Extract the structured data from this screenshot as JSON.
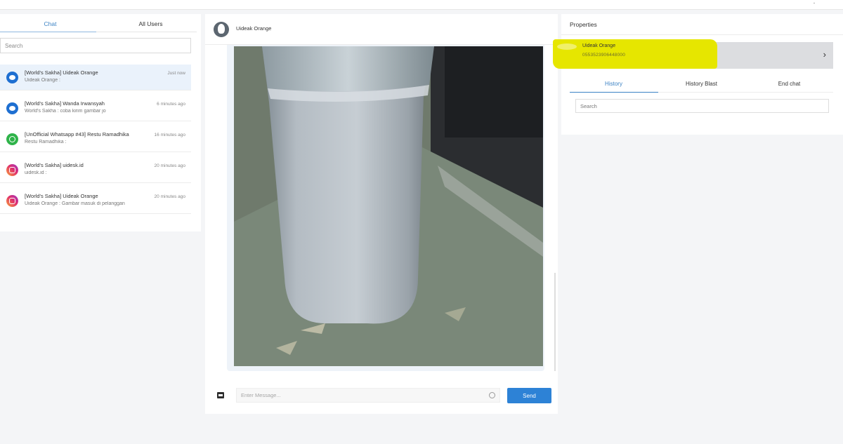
{
  "left_panel": {
    "tabs": [
      {
        "label": "Chat",
        "active": true
      },
      {
        "label": "All Users",
        "active": false
      }
    ],
    "search_placeholder": "Search",
    "conversations": [
      {
        "channel": "messenger",
        "icon": "messenger-icon",
        "title": "[World's Sakha] Uideak Orange",
        "preview": "Uideak Orange :",
        "time": "Just now",
        "active": true
      },
      {
        "channel": "messenger",
        "icon": "messenger-icon",
        "title": "[World's Sakha] Wanda Irwansyah",
        "preview": "World's Sakha : coba kirim gambar jo",
        "time": "6 minutes ago",
        "active": false
      },
      {
        "channel": "whatsapp",
        "icon": "whatsapp-icon",
        "title": "[UnOfficial Whatsapp #43] Restu Ramadhika",
        "preview": "Restu Ramadhika :",
        "time": "16 minutes ago",
        "active": false
      },
      {
        "channel": "instagram",
        "icon": "instagram-icon",
        "title": "[World's Sakha] uidesk.id",
        "preview": "uidesk.id :",
        "time": "20 minutes ago",
        "active": false
      },
      {
        "channel": "instagram",
        "icon": "instagram-icon",
        "title": "[World's Sakha] Uideak Orange",
        "preview": "Uideak Orange : Gambar masuk di pelanggan",
        "time": "20 minutes ago",
        "active": false
      }
    ]
  },
  "chat": {
    "contact_name": "Uideak Orange",
    "input_placeholder": "Enter Message...",
    "send_label": "Send"
  },
  "properties": {
    "title": "Properties",
    "contact": {
      "name": "Uideak Orange",
      "phone": "0553523906448000"
    },
    "tabs": [
      {
        "label": "History",
        "active": true
      },
      {
        "label": "History Blast",
        "active": false
      },
      {
        "label": "End chat",
        "active": false
      }
    ],
    "search_placeholder": "Search"
  },
  "colors": {
    "accent": "#2d82d6",
    "highlight": "#e6e600",
    "active_row": "#eaf2fb"
  }
}
